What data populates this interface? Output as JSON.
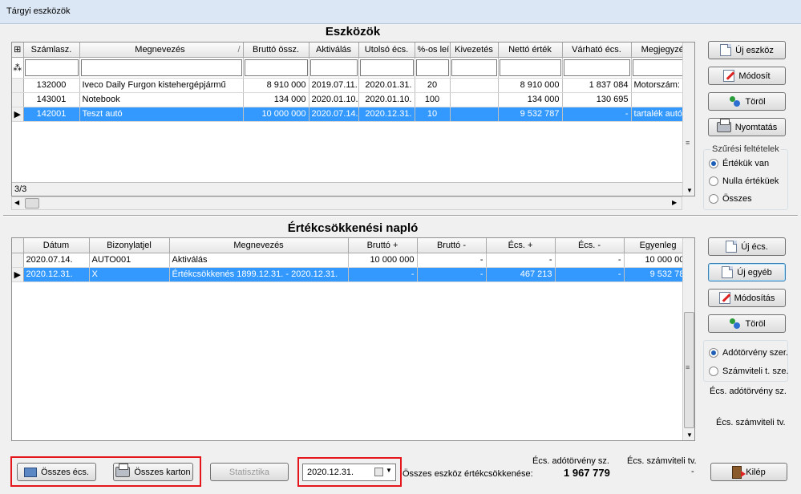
{
  "window": {
    "title": "Tárgyi eszközök"
  },
  "assets": {
    "title": "Eszközök",
    "columns": [
      "Számlasz.",
      "Megnevezés",
      "Bruttó össz.",
      "Aktiválás",
      "Utolsó écs.",
      "%-os leír.",
      "Kivezetés",
      "Nettó érték",
      "Várható écs.",
      "Megjegyzés"
    ],
    "rows": [
      [
        "132000",
        "Iveco Daily Furgon kistehergépjármű",
        "8 910 000",
        "2019.07.11.",
        "2020.01.31.",
        "20",
        "",
        "8 910 000",
        "1 837 084",
        "Motorszám: xxx  ."
      ],
      [
        "143001",
        "Notebook",
        "134 000",
        "2020.01.10.",
        "2020.01.10.",
        "100",
        "",
        "134 000",
        "130 695",
        ""
      ],
      [
        "142001",
        "Teszt autó",
        "10 000 000",
        "2020.07.14.",
        "2020.12.31.",
        "10",
        "",
        "9 532 787",
        "-",
        "tartalék autó"
      ]
    ],
    "selected_row": 2,
    "record_count": "3/3"
  },
  "asset_buttons": {
    "new": "Új eszköz",
    "edit": "Módosít",
    "delete": "Töröl",
    "print": "Nyomtatás"
  },
  "filter": {
    "title": "Szűrési feltételek",
    "options": [
      "Értékük van",
      "Nulla értéküek",
      "Összes"
    ],
    "selected": 0
  },
  "log": {
    "title": "Értékcsökkenési napló",
    "columns": [
      "Dátum",
      "Bizonylatjel",
      "Megnevezés",
      "Bruttó +",
      "Bruttó -",
      "Écs. +",
      "Écs. -",
      "Egyenleg"
    ],
    "rows": [
      [
        "2020.07.14.",
        "AUTO001",
        "Aktiválás",
        "10 000 000",
        "-",
        "-",
        "-",
        "10 000 000"
      ],
      [
        "2020.12.31.",
        "X",
        "Értékcsökkenés 1899.12.31. - 2020.12.31.",
        "-",
        "-",
        "467 213",
        "-",
        "9 532 787"
      ]
    ],
    "selected_row": 1
  },
  "log_buttons": {
    "new_ecs": "Új écs.",
    "new_other": "Új egyéb",
    "edit": "Módosítás",
    "delete": "Töröl"
  },
  "law": {
    "options": [
      "Adótörvény szer.",
      "Számviteli t. sze."
    ],
    "selected": 0,
    "label_tax": "Écs. adótörvény sz.",
    "label_acc": "Écs. számviteli tv."
  },
  "bottom": {
    "all_ecs": "Összes écs.",
    "all_cards": "Összes karton",
    "stats": "Statisztika",
    "date": "2020.12.31.",
    "total_label": "Összes eszköz értékcsökkenése:",
    "tax_header": "Écs. adótörvény sz.",
    "tax_value": "1 967 779",
    "acc_header": "Écs. számviteli tv.",
    "acc_value": "-",
    "exit": "Kilép"
  }
}
